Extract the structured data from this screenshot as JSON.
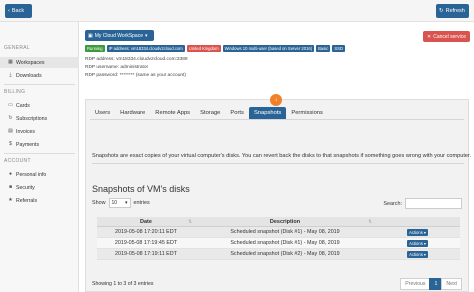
{
  "topbar": {
    "back_label": "Back",
    "refresh_label": "Refresh"
  },
  "sidebar": {
    "sections": [
      {
        "heading": "GENERAL",
        "items": [
          {
            "label": "Workspaces",
            "icon": "workspaces-icon",
            "active": true
          },
          {
            "label": "Downloads",
            "icon": "download-icon"
          }
        ]
      },
      {
        "heading": "BILLING",
        "items": [
          {
            "label": "Cards",
            "icon": "card-icon"
          },
          {
            "label": "Subscriptions",
            "icon": "subscriptions-icon"
          },
          {
            "label": "Invoices",
            "icon": "invoice-icon"
          },
          {
            "label": "Payments",
            "icon": "payments-icon"
          }
        ]
      },
      {
        "heading": "ACCOUNT",
        "items": [
          {
            "label": "Personal info",
            "icon": "user-icon"
          },
          {
            "label": "Security",
            "icon": "lock-icon"
          },
          {
            "label": "Referrals",
            "icon": "referrals-icon"
          }
        ]
      }
    ]
  },
  "workspace": {
    "selector_label": "My Cloud WorkSpace",
    "cancel_label": "Cancel service",
    "badges": [
      "Running",
      "IP address: vm18334.cloudv2cloud.com",
      "United Kingdom",
      "Windows 10 multi-user (based on Server 2016)",
      "Basic",
      "SSD"
    ],
    "rdp_address": "RDP address: vm18334.cloudv2cloud.com:3389",
    "rdp_username": "RDP username: administrator",
    "rdp_password": "RDP password: ******** (same as your account)"
  },
  "tabs": [
    "Users",
    "Hardware",
    "Remote Apps",
    "Storage",
    "Ports",
    "Snapshots",
    "Permissions"
  ],
  "active_tab": "Snapshots",
  "snapshots": {
    "description": "Snapshots are exact copies of your virtual computer's disks. You can revert back the disks to that snapshots if something goes wrong with your computer.",
    "title": "Snapshots of VM's disks",
    "show_label": "Show",
    "show_value": "10",
    "entries_label": "entries",
    "search_label": "Search:",
    "columns": [
      "Date",
      "Description",
      ""
    ],
    "rows": [
      {
        "date": "2019-05-08 17:20:11 EDT",
        "description": "Scheduled snapshot (Disk #1) - May 08, 2019",
        "action": "Actions"
      },
      {
        "date": "2019-05-08 17:19:45 EDT",
        "description": "Scheduled snapshot (Disk #1) - May 08, 2019",
        "action": "Actions"
      },
      {
        "date": "2019-05-08 17:19:11 EDT",
        "description": "Scheduled snapshot (Disk #2) - May 08, 2019",
        "action": "Actions"
      }
    ],
    "footer": "Showing 1 to 3 of 3 entries",
    "pager": {
      "previous": "Previous",
      "current": "1",
      "next": "Next"
    }
  },
  "colors": {
    "primary": "#2a6496",
    "danger": "#d9534f",
    "success": "#3c9a3c",
    "accent": "#f0812a"
  }
}
